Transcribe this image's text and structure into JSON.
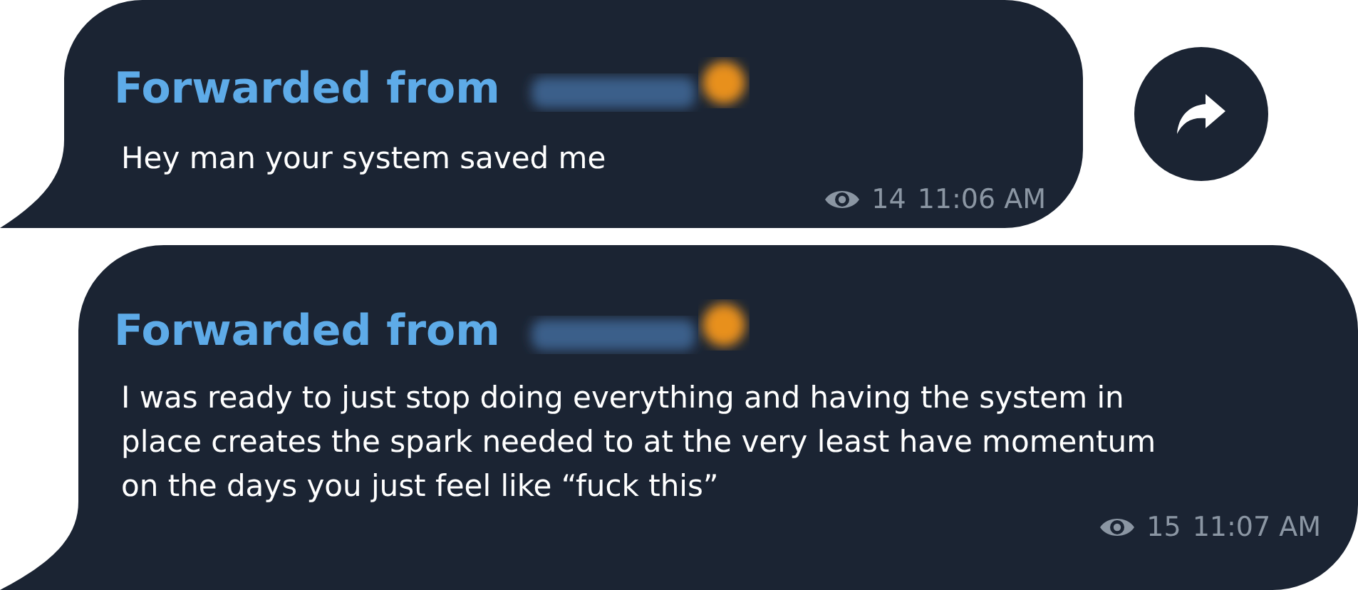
{
  "messages": [
    {
      "forwarded_label": "Forwarded from",
      "text": "Hey man your system saved me",
      "views": "14",
      "time": "11:06 AM",
      "share_button": true
    },
    {
      "forwarded_label": "Forwarded from",
      "text": "I was ready to just stop doing everything and having the system in\nplace creates the spark needed to at the very least have momentum\non the days you just feel like “fuck this”",
      "views": "15",
      "time": "11:07 AM",
      "share_button": false
    }
  ]
}
